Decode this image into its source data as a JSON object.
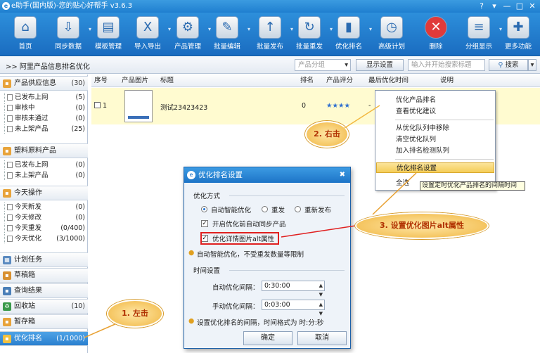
{
  "window": {
    "title": "e助手(国内版)-您的贴心好帮手 v3.6.3",
    "controls": [
      "?",
      "▾",
      "—",
      "□",
      "✕"
    ]
  },
  "toolbar": [
    {
      "label": "首页",
      "icon": "home-icon",
      "glyph": "⌂"
    },
    {
      "label": "同步数据",
      "icon": "download-icon",
      "glyph": "⇩"
    },
    {
      "label": "模板管理",
      "icon": "template-icon",
      "glyph": "▤"
    },
    {
      "label": "导入导出",
      "icon": "excel-icon",
      "glyph": "X"
    },
    {
      "label": "产品管理",
      "icon": "product-icon",
      "glyph": "⚙"
    },
    {
      "label": "批量编辑",
      "icon": "edit-icon",
      "glyph": "✎"
    },
    {
      "label": "批量发布",
      "icon": "publish-icon",
      "glyph": "↑"
    },
    {
      "label": "批量重发",
      "icon": "republish-icon",
      "glyph": "↻"
    },
    {
      "label": "优化排名",
      "icon": "rank-icon",
      "glyph": "▮"
    },
    {
      "label": "高级计划",
      "icon": "schedule-icon",
      "glyph": "◷"
    },
    {
      "label": "删除",
      "icon": "delete-icon",
      "glyph": "✕"
    },
    {
      "label": "分组显示",
      "icon": "group-icon",
      "glyph": "≡"
    },
    {
      "label": "更多功能",
      "icon": "more-icon",
      "glyph": "✚"
    }
  ],
  "breadcrumb": ">> 阿里产品信息排名优化",
  "filter": {
    "group_placeholder": "产品分组",
    "show_settings": "显示设置",
    "search_placeholder": "输入并开始搜索标题",
    "search_button": "搜索"
  },
  "sidebar": {
    "supply": {
      "label": "产品供应信息",
      "count": "(30)",
      "items": [
        {
          "label": "已发布上网",
          "count": "(5)"
        },
        {
          "label": "审核中",
          "count": "(0)"
        },
        {
          "label": "审核未通过",
          "count": "(0)"
        },
        {
          "label": "未上架产品",
          "count": "(25)"
        }
      ]
    },
    "plastic": {
      "label": "塑料原料产品",
      "items": [
        {
          "label": "已发布上网",
          "count": "(0)"
        },
        {
          "label": "未上架产品",
          "count": "(0)"
        }
      ]
    },
    "today": {
      "label": "今天操作",
      "items": [
        {
          "label": "今天新发",
          "count": "(0)"
        },
        {
          "label": "今天修改",
          "count": "(0)"
        },
        {
          "label": "今天重发",
          "count": "(0/400)"
        },
        {
          "label": "今天优化",
          "count": "(3/1000)"
        }
      ]
    },
    "plan": "计划任务",
    "draft": "草稿箱",
    "query": "查询结果",
    "recycle": {
      "label": "回收站",
      "count": "(10)"
    },
    "storage": "暂存箱",
    "optimize": {
      "label": "优化排名",
      "count": "(1/1000)"
    }
  },
  "table": {
    "headers": [
      "序号",
      "产品图片",
      "标题",
      "排名",
      "产品评分",
      "最后优化时间",
      "说明"
    ],
    "row": {
      "index": "1",
      "title": "测试23423423",
      "rank": "0",
      "stars": "★★★★",
      "last": "-"
    }
  },
  "context_menu": [
    "优化产品排名",
    "查看优化建议",
    "从优化队列中移除",
    "清空优化队列",
    "加入排名检测队列",
    "优化排名设置",
    "全选"
  ],
  "tooltip": "设置定时优化产品排名的间隔时间",
  "dialog": {
    "title": "优化排名设置",
    "section1": "优化方式",
    "radios": [
      "自动智能优化",
      "重发",
      "重新发布"
    ],
    "check1": "开启优化前自动同步产品",
    "check2": "优化详情图片alt属性",
    "tip1": "自动智能优化，不受重发数量等限制",
    "section2": "时间设置",
    "auto_label": "自动优化间隔：",
    "auto_value": "0:30:00",
    "manual_label": "手动优化间隔：",
    "manual_value": "0:03:00",
    "tip2": "设置优化排名的间隔，时间格式为 时:分:秒",
    "ok": "确定",
    "cancel": "取消"
  },
  "callouts": {
    "step1": "1. 左击",
    "step2": "2. 右击",
    "step3": "3. 设置优化图片alt属性"
  }
}
